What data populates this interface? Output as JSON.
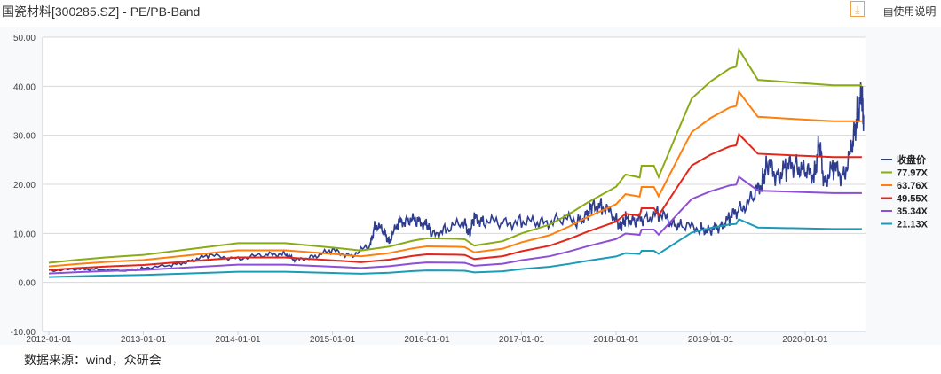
{
  "header": {
    "title": "国瓷材料[300285.SZ] - PE/PB-Band",
    "download_icon": "download-icon",
    "help_label": "使用说明"
  },
  "source": "数据来源：wind，众研会",
  "chart_data": {
    "type": "line",
    "title": "国瓷材料[300285.SZ] - PE/PB-Band",
    "ylim": [
      -10,
      50
    ],
    "yticks": [
      "50.00",
      "40.00",
      "30.00",
      "20.00",
      "10.00",
      "0.00",
      "-10.00"
    ],
    "ytick_values": [
      50,
      40,
      30,
      20,
      10,
      0,
      -10
    ],
    "xticks": [
      "2012-01-01",
      "2013-01-01",
      "2014-01-01",
      "2015-01-01",
      "2016-01-01",
      "2017-01-01",
      "2018-01-01",
      "2019-01-01",
      "2020-01-01"
    ],
    "xtick_values": [
      2012,
      2013,
      2014,
      2015,
      2016,
      2017,
      2018,
      2019,
      2020
    ],
    "xlim": [
      2011.95,
      2020.7
    ],
    "legend_position": "right",
    "band_base": {
      "name": "77.97X",
      "x": [
        2012.0,
        2012.3,
        2012.6,
        2013.0,
        2013.5,
        2014.0,
        2014.5,
        2015.0,
        2015.3,
        2015.6,
        2015.85,
        2016.0,
        2016.3,
        2016.4,
        2016.5,
        2016.8,
        2017.0,
        2017.3,
        2017.5,
        2017.7,
        2018.0,
        2018.1,
        2018.25,
        2018.27,
        2018.4,
        2018.45,
        2018.7,
        2018.8,
        2019.0,
        2019.2,
        2019.27,
        2019.3,
        2019.5,
        2020.0,
        2020.3,
        2020.6
      ],
      "values": [
        4,
        4.6,
        5.1,
        5.6,
        6.8,
        8,
        8,
        7.1,
        6.5,
        7.3,
        8.5,
        9,
        8.9,
        8.8,
        7.5,
        8.4,
        10,
        11.8,
        13.9,
        16.3,
        19.5,
        22,
        21.4,
        23.8,
        23.8,
        21.5,
        33,
        37.5,
        41,
        43.6,
        44,
        47.5,
        41.3,
        40.6,
        40.2,
        40.2
      ]
    },
    "series": [
      {
        "name": "收盘价",
        "color": "#2e3d8f",
        "multiple": null,
        "x": [
          2012.0,
          2012.3,
          2012.5,
          2012.8,
          2013.0,
          2013.3,
          2013.5,
          2013.7,
          2014.0,
          2014.3,
          2014.5,
          2014.6,
          2014.8,
          2015.0,
          2015.2,
          2015.4,
          2015.45,
          2015.55,
          2015.6,
          2015.7,
          2015.8,
          2015.9,
          2016.0,
          2016.05,
          2016.2,
          2016.4,
          2016.45,
          2016.5,
          2016.6,
          2016.8,
          2017.0,
          2017.2,
          2017.4,
          2017.6,
          2017.7,
          2017.75,
          2017.85,
          2018.0,
          2018.05,
          2018.1,
          2018.2,
          2018.3,
          2018.45,
          2018.6,
          2018.7,
          2018.9,
          2019.0,
          2019.1,
          2019.2,
          2019.3,
          2019.45,
          2019.55,
          2019.6,
          2019.7,
          2019.8,
          2019.9,
          2020.0,
          2020.1,
          2020.15,
          2020.2,
          2020.3,
          2020.4,
          2020.5,
          2020.55,
          2020.6,
          2020.62
        ],
        "values": [
          2.5,
          2.6,
          2.8,
          2.3,
          3,
          3.4,
          4.5,
          5.4,
          5,
          5.5,
          6,
          4.4,
          5.4,
          6.4,
          5.5,
          7.5,
          12,
          10,
          8.5,
          12,
          13,
          12.3,
          12,
          9.5,
          11,
          12,
          10,
          13,
          12.6,
          12,
          12.5,
          12,
          13,
          12.5,
          14,
          15.6,
          15.5,
          13,
          11,
          13,
          12.5,
          13,
          14,
          12,
          11.5,
          11,
          10.5,
          11.5,
          13,
          15,
          17,
          21,
          24,
          22,
          23,
          24.5,
          22,
          22.5,
          28,
          21,
          23,
          22,
          27,
          35,
          37,
          34
        ]
      },
      {
        "name": "77.97X",
        "color": "#8aab16",
        "multiple": 77.97
      },
      {
        "name": "63.76X",
        "color": "#ff7f0e",
        "multiple": 63.76
      },
      {
        "name": "49.55X",
        "color": "#e5251a",
        "multiple": 49.55
      },
      {
        "name": "35.34X",
        "color": "#8d4fd6",
        "multiple": 35.34
      },
      {
        "name": "21.13X",
        "color": "#1a9bb8",
        "multiple": 21.13
      }
    ]
  }
}
